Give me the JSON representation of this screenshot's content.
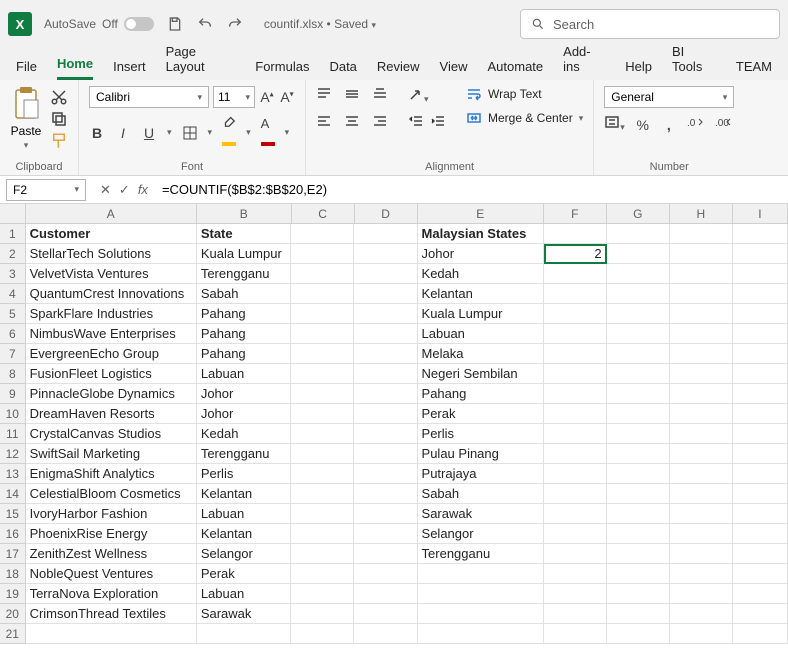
{
  "titlebar": {
    "autosave_label": "AutoSave",
    "autosave_state": "Off",
    "filename": "countif.xlsx • Saved",
    "search_placeholder": "Search"
  },
  "tabs": [
    "File",
    "Home",
    "Insert",
    "Page Layout",
    "Formulas",
    "Data",
    "Review",
    "View",
    "Automate",
    "Add-ins",
    "Help",
    "BI Tools",
    "TEAM"
  ],
  "active_tab": "Home",
  "ribbon": {
    "clipboard": {
      "paste": "Paste",
      "group": "Clipboard"
    },
    "font": {
      "name": "Calibri",
      "size": "11",
      "group": "Font"
    },
    "alignment": {
      "wrap": "Wrap Text",
      "merge": "Merge & Center",
      "group": "Alignment"
    },
    "number": {
      "format": "General",
      "group": "Number"
    }
  },
  "formula_bar": {
    "namebox": "F2",
    "formula": "=COUNTIF($B$2:$B$20,E2)"
  },
  "columns": [
    "A",
    "B",
    "C",
    "D",
    "E",
    "F",
    "G",
    "H",
    "I"
  ],
  "headers": {
    "A": "Customer",
    "B": "State",
    "E": "Malaysian States"
  },
  "data": [
    {
      "A": "StellarTech Solutions",
      "B": "Kuala Lumpur",
      "E": "Johor",
      "F": "2"
    },
    {
      "A": "VelvetVista Ventures",
      "B": "Terengganu",
      "E": "Kedah"
    },
    {
      "A": "QuantumCrest Innovations",
      "B": "Sabah",
      "E": "Kelantan"
    },
    {
      "A": "SparkFlare Industries",
      "B": "Pahang",
      "E": "Kuala Lumpur"
    },
    {
      "A": "NimbusWave Enterprises",
      "B": "Pahang",
      "E": "Labuan"
    },
    {
      "A": "EvergreenEcho Group",
      "B": "Pahang",
      "E": "Melaka"
    },
    {
      "A": "FusionFleet Logistics",
      "B": "Labuan",
      "E": "Negeri Sembilan"
    },
    {
      "A": "PinnacleGlobe Dynamics",
      "B": "Johor",
      "E": "Pahang"
    },
    {
      "A": "DreamHaven Resorts",
      "B": "Johor",
      "E": "Perak"
    },
    {
      "A": "CrystalCanvas Studios",
      "B": "Kedah",
      "E": "Perlis"
    },
    {
      "A": "SwiftSail Marketing",
      "B": "Terengganu",
      "E": "Pulau Pinang"
    },
    {
      "A": "EnigmaShift Analytics",
      "B": "Perlis",
      "E": "Putrajaya"
    },
    {
      "A": "CelestialBloom Cosmetics",
      "B": "Kelantan",
      "E": "Sabah"
    },
    {
      "A": "IvoryHarbor Fashion",
      "B": "Labuan",
      "E": "Sarawak"
    },
    {
      "A": "PhoenixRise Energy",
      "B": "Kelantan",
      "E": "Selangor"
    },
    {
      "A": "ZenithZest Wellness",
      "B": "Selangor",
      "E": "Terengganu"
    },
    {
      "A": "NobleQuest Ventures",
      "B": "Perak"
    },
    {
      "A": "TerraNova Exploration",
      "B": "Labuan"
    },
    {
      "A": "CrimsonThread Textiles",
      "B": "Sarawak"
    }
  ],
  "selected_cell": "F2",
  "colors": {
    "accent": "#107c41",
    "fill": "#ffc000",
    "font_color": "#c00000"
  }
}
